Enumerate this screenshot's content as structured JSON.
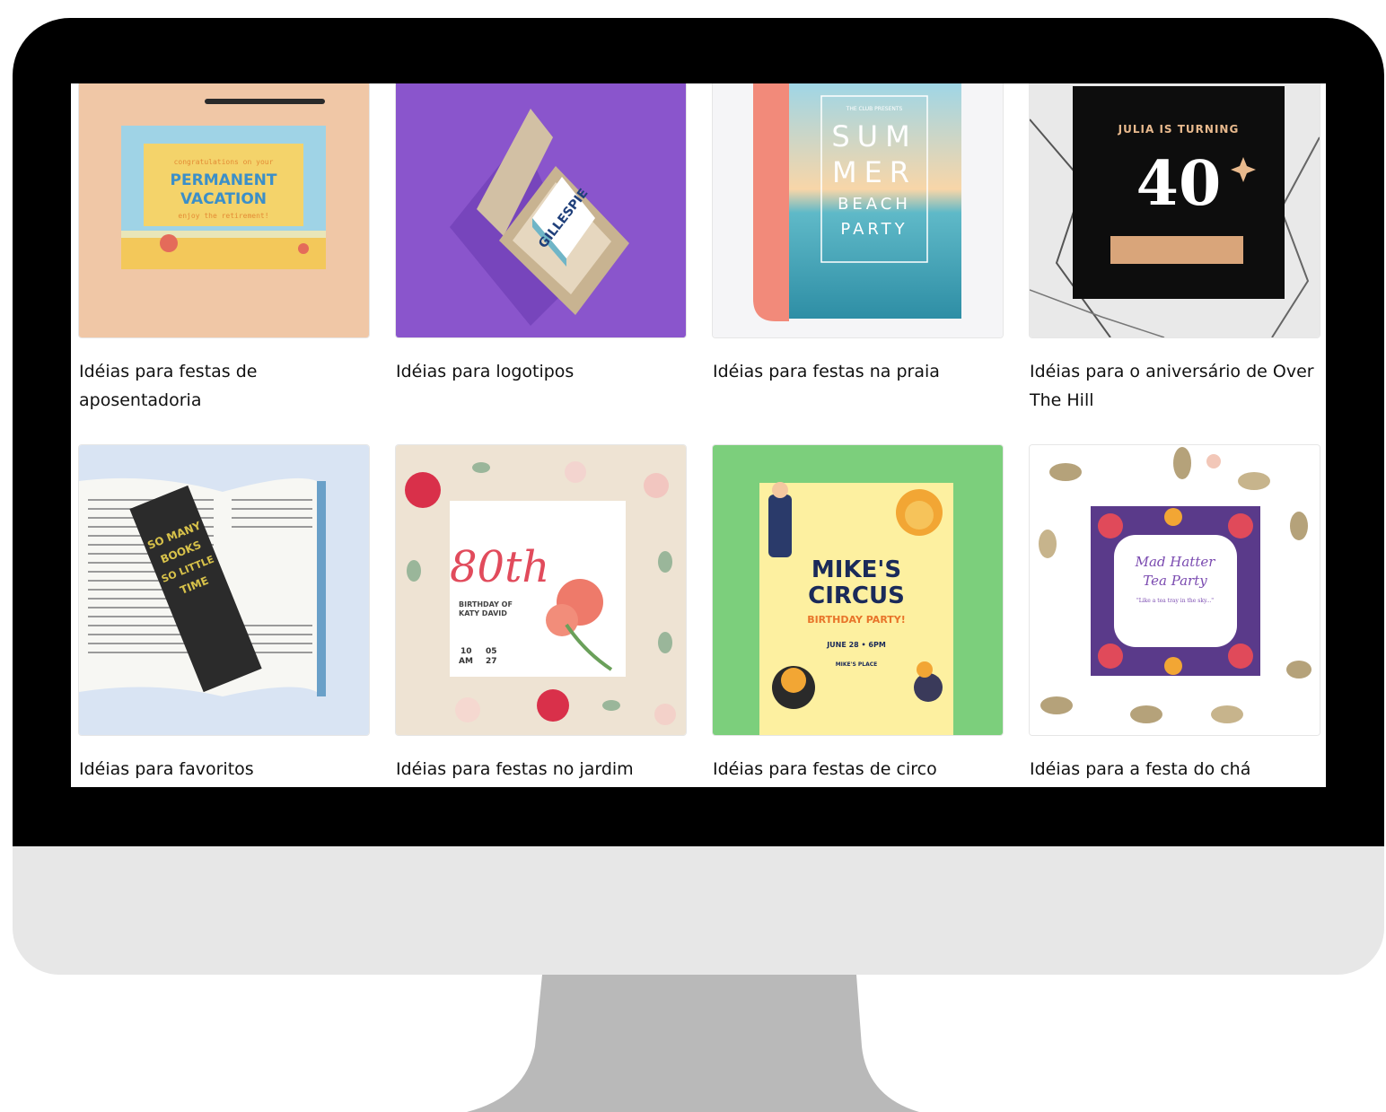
{
  "gallery": {
    "cards": [
      {
        "title": "Idéias para festas de aposentadoria",
        "thumb": {
          "line1": "congratulations on your",
          "line2": "PERMANENT",
          "line3": "VACATION",
          "line4": "enjoy the retirement!"
        }
      },
      {
        "title": "Idéias para logotipos",
        "thumb": {
          "brand": "GILLESPIE"
        }
      },
      {
        "title": "Idéias para festas na praia",
        "thumb": {
          "line1": "THE CLUB PRESENTS",
          "line2": "SUM",
          "line3": "MER",
          "line4": "BEACH",
          "line5": "PARTY"
        }
      },
      {
        "title": "Idéias para o aniversário de Over The Hill",
        "thumb": {
          "line1": "JULIA IS TURNING",
          "line2": "40"
        }
      },
      {
        "title": "Idéias para favoritos",
        "thumb": {
          "line1": "SO MANY",
          "line2": "BOOKS",
          "line3": "SO LITTLE",
          "line4": "TIME"
        }
      },
      {
        "title": "Idéias para festas no jardim",
        "thumb": {
          "line1": "80th",
          "line2": "BIRTHDAY OF",
          "line3": "KATY DAVID",
          "line4": "10",
          "line5": "AM",
          "line6": "05",
          "line7": "27"
        }
      },
      {
        "title": "Idéias para festas de circo",
        "thumb": {
          "line1": "MIKE'S",
          "line2": "CIRCUS",
          "line3": "BIRTHDAY PARTY!",
          "line4": "JUNE 28 • 6PM",
          "line5": "MIKE'S PLACE"
        }
      },
      {
        "title": "Idéias para a festa do chá",
        "thumb": {
          "line1": "Mad Hatter",
          "line2": "Tea Party",
          "line3": "\"Like a tea tray in the sky...\""
        }
      }
    ]
  }
}
